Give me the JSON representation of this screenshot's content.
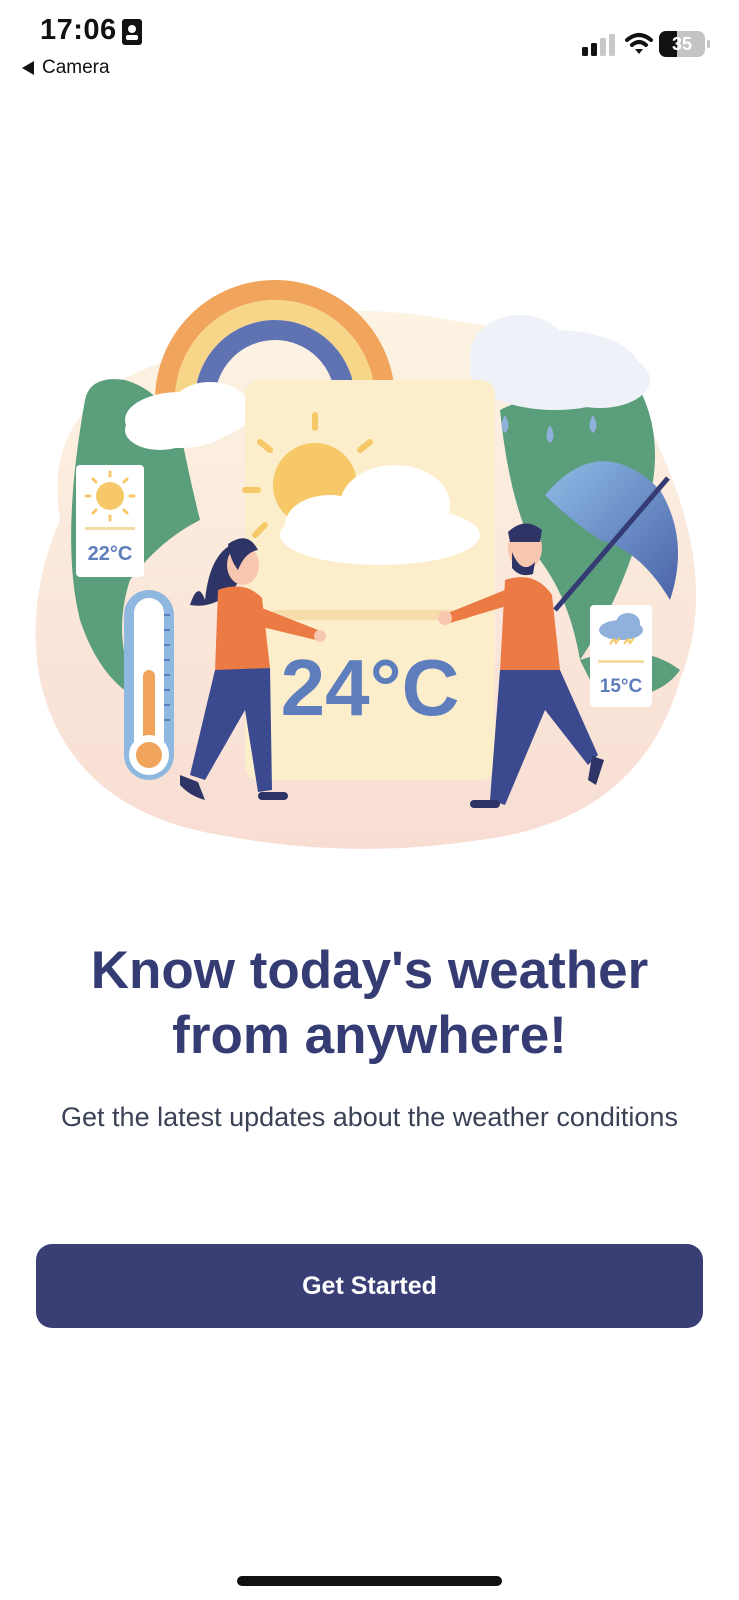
{
  "status_bar": {
    "time": "17:06",
    "battery": "35",
    "back_label": "Camera"
  },
  "illustration": {
    "center_temp": "24°C",
    "left_card_temp": "22°C",
    "right_card_temp": "15°C"
  },
  "onboarding": {
    "headline_line1": "Know today's weather",
    "headline_line2": "from anywhere!",
    "subtitle": "Get the latest updates about the weather conditions",
    "cta_label": "Get Started"
  },
  "colors": {
    "primary": "#393e75",
    "headline": "#353c73",
    "text": "#3b4256"
  },
  "icons": [
    "id-badge-icon",
    "back-arrow-icon",
    "signal-icon",
    "wifi-icon",
    "battery-icon",
    "sun-icon",
    "cloud-icon",
    "rainbow-icon",
    "thermometer-icon",
    "umbrella-icon",
    "rain-cloud-icon"
  ]
}
